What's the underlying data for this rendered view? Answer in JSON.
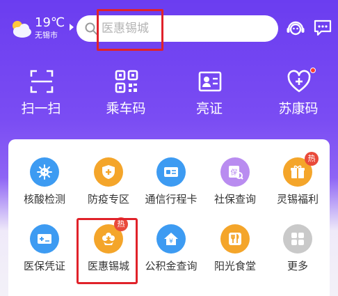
{
  "weather": {
    "temp": "19℃",
    "city": "无锡市",
    "icon": "partly-cloudy-icon"
  },
  "search": {
    "placeholder": "医惠锡城",
    "icon": "search-icon"
  },
  "header_actions": [
    {
      "name": "customer-service-icon"
    },
    {
      "name": "message-icon"
    }
  ],
  "quick_actions": [
    {
      "label": "扫一扫",
      "icon": "scan-icon"
    },
    {
      "label": "乘车码",
      "icon": "qr-code-icon"
    },
    {
      "label": "亮证",
      "icon": "id-card-icon"
    },
    {
      "label": "苏康码",
      "icon": "health-heart-icon",
      "has_dot": true
    }
  ],
  "services": [
    {
      "label": "核酸检测",
      "icon": "virus-icon",
      "color": "#3d9bf2"
    },
    {
      "label": "防疫专区",
      "icon": "shield-plus-icon",
      "color": "#f4a52a"
    },
    {
      "label": "通信行程卡",
      "icon": "travel-card-icon",
      "color": "#3d9bf2"
    },
    {
      "label": "社保查询",
      "icon": "social-security-icon",
      "color": "#b98cf0"
    },
    {
      "label": "灵锡福利",
      "icon": "gift-icon",
      "color": "#f4a52a",
      "badge": "热"
    },
    {
      "label": "医保凭证",
      "icon": "medical-card-icon",
      "color": "#3d9bf2"
    },
    {
      "label": "医惠锡城",
      "icon": "medical-flower-icon",
      "color": "#f4a52a",
      "badge": "热"
    },
    {
      "label": "公积金查询",
      "icon": "housing-fund-icon",
      "color": "#3d9bf2"
    },
    {
      "label": "阳光食堂",
      "icon": "canteen-icon",
      "color": "#f4a52a"
    },
    {
      "label": "更多",
      "icon": "more-grid-icon",
      "color": "#c9c9c9"
    }
  ],
  "colors": {
    "accent": "#6b3df0",
    "highlight": "#e0222a",
    "hot": "#e94a3a"
  }
}
